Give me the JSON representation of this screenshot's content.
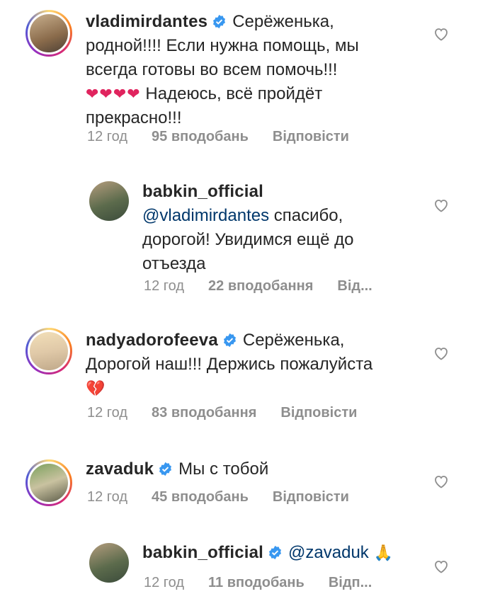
{
  "comments": [
    {
      "username": "vladimirdantes",
      "verified": true,
      "text": "Серёженька, родной!!!! Если нужна помощь, мы всегда готовы во всем помочь!!!",
      "emoji_line": "❤❤❤❤",
      "text2": "Надеюсь, всё пройдёт прекрасно!!!",
      "time": "12 год",
      "likes": "95 вподобань",
      "reply": "Відповісти"
    },
    {
      "username": "babkin_official",
      "verified": false,
      "mention": "@vladimirdantes",
      "text": "спасибо, дорогой! Увидимся ещё до отъезда",
      "time": "12 год",
      "likes": "22 вподобання",
      "reply": "Від..."
    },
    {
      "username": "nadyadorofeeva",
      "verified": true,
      "text": "Серёженька, Дорогой наш!!! Держись пожалуйста",
      "emoji_line": "💔",
      "time": "12 год",
      "likes": "83 вподобання",
      "reply": "Відповісти"
    },
    {
      "username": "zavaduk",
      "verified": true,
      "text": "Мы с тобой",
      "time": "12 год",
      "likes": "45 вподобань",
      "reply": "Відповісти"
    },
    {
      "username": "babkin_official",
      "verified": true,
      "mention": "@zavaduk",
      "emoji_line": "🙏",
      "time": "12 год",
      "likes": "11 вподобань",
      "reply": "Відп..."
    }
  ],
  "colors": {
    "verified": "#3897f0",
    "mention": "#00376b",
    "meta": "#8e8e8e",
    "text": "#262626"
  },
  "icons": {
    "like": "heart-outline-icon",
    "verified": "verified-badge-icon"
  }
}
